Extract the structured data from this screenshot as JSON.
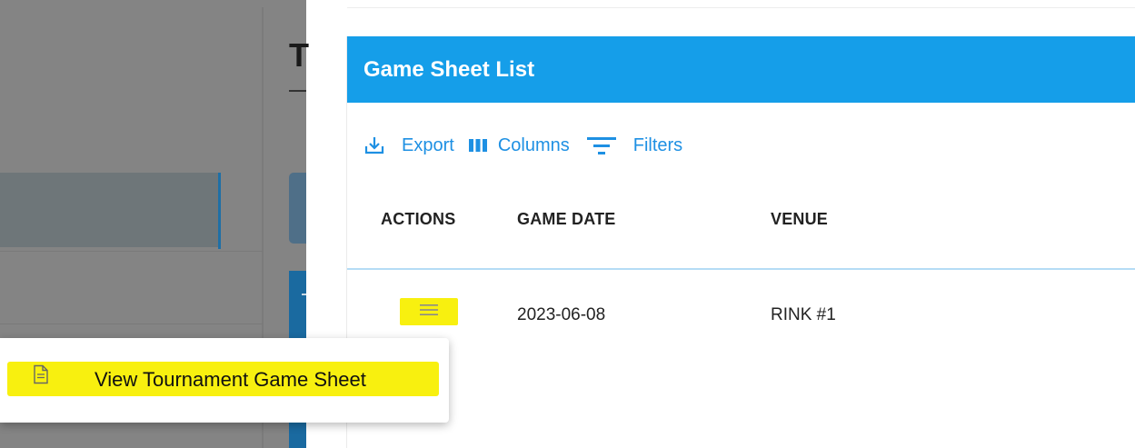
{
  "background_panel": {
    "partial_heading": "T"
  },
  "card": {
    "title": "Game Sheet List",
    "header_color": "#159ee9",
    "accent_color": "#1e90e3",
    "highlight_color": "#f8f00f"
  },
  "toolbar": {
    "export_label": "Export",
    "export_icon": "download-icon",
    "columns_label": "Columns",
    "columns_icon": "view-column-icon",
    "filters_label": "Filters",
    "filters_icon": "filter-list-icon"
  },
  "table": {
    "headers": [
      "ACTIONS",
      "GAME DATE",
      "VENUE"
    ],
    "rows": [
      {
        "actions_icon": "menu-icon",
        "game_date": "2023-06-08",
        "venue": "RINK #1"
      }
    ]
  },
  "action_menu": {
    "items": [
      {
        "label": "View Tournament Game Sheet",
        "icon": "document-icon"
      }
    ]
  }
}
